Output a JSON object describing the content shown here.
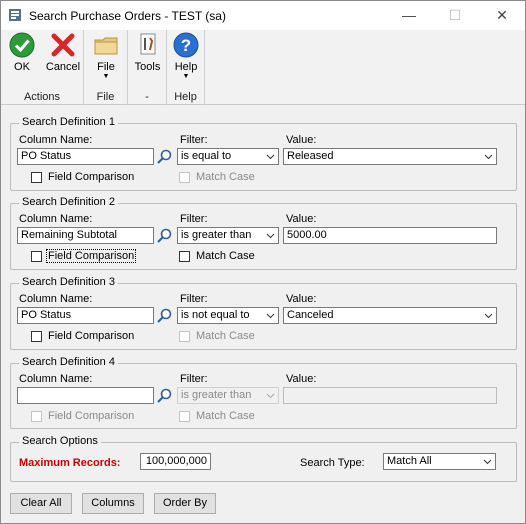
{
  "window": {
    "title": "Search Purchase Orders  -  TEST (sa)",
    "minimize_glyph": "—",
    "maximize_glyph": "☐",
    "close_glyph": "✕"
  },
  "ribbon": {
    "ok_label": "OK",
    "cancel_label": "Cancel",
    "actions_group": "Actions",
    "file_label": "File",
    "file_group": "File",
    "tools_label": "Tools",
    "tools_group": "-",
    "help_label": "Help",
    "help_group": "Help",
    "dropdown_glyph": "▼"
  },
  "definitions": [
    {
      "legend": "Search Definition 1",
      "column_label": "Column Name:",
      "column_value": "PO Status",
      "filter_label": "Filter:",
      "filter_value": "is equal to",
      "value_label": "Value:",
      "value_value": "Released",
      "field_comparison": "Field Comparison",
      "match_case": "Match Case"
    },
    {
      "legend": "Search Definition 2",
      "column_label": "Column Name:",
      "column_value": "Remaining Subtotal",
      "filter_label": "Filter:",
      "filter_value": "is greater than",
      "value_label": "Value:",
      "value_value": "5000.00",
      "field_comparison": "Field Comparison",
      "match_case": "Match Case"
    },
    {
      "legend": "Search Definition 3",
      "column_label": "Column Name:",
      "column_value": "PO Status",
      "filter_label": "Filter:",
      "filter_value": "is not equal to",
      "value_label": "Value:",
      "value_value": "Canceled",
      "field_comparison": "Field Comparison",
      "match_case": "Match Case"
    },
    {
      "legend": "Search Definition 4",
      "column_label": "Column Name:",
      "column_value": "",
      "filter_label": "Filter:",
      "filter_value": "is greater than",
      "value_label": "Value:",
      "value_value": "",
      "field_comparison": "Field Comparison",
      "match_case": "Match Case"
    }
  ],
  "options": {
    "legend": "Search Options",
    "max_records_label": "Maximum Records:",
    "max_records_value": "100,000,000",
    "search_type_label": "Search Type:",
    "search_type_value": "Match All",
    "max_records_color": "#cc0000"
  },
  "buttons": {
    "clear_all": "Clear All",
    "columns": "Columns",
    "order_by": "Order By"
  }
}
